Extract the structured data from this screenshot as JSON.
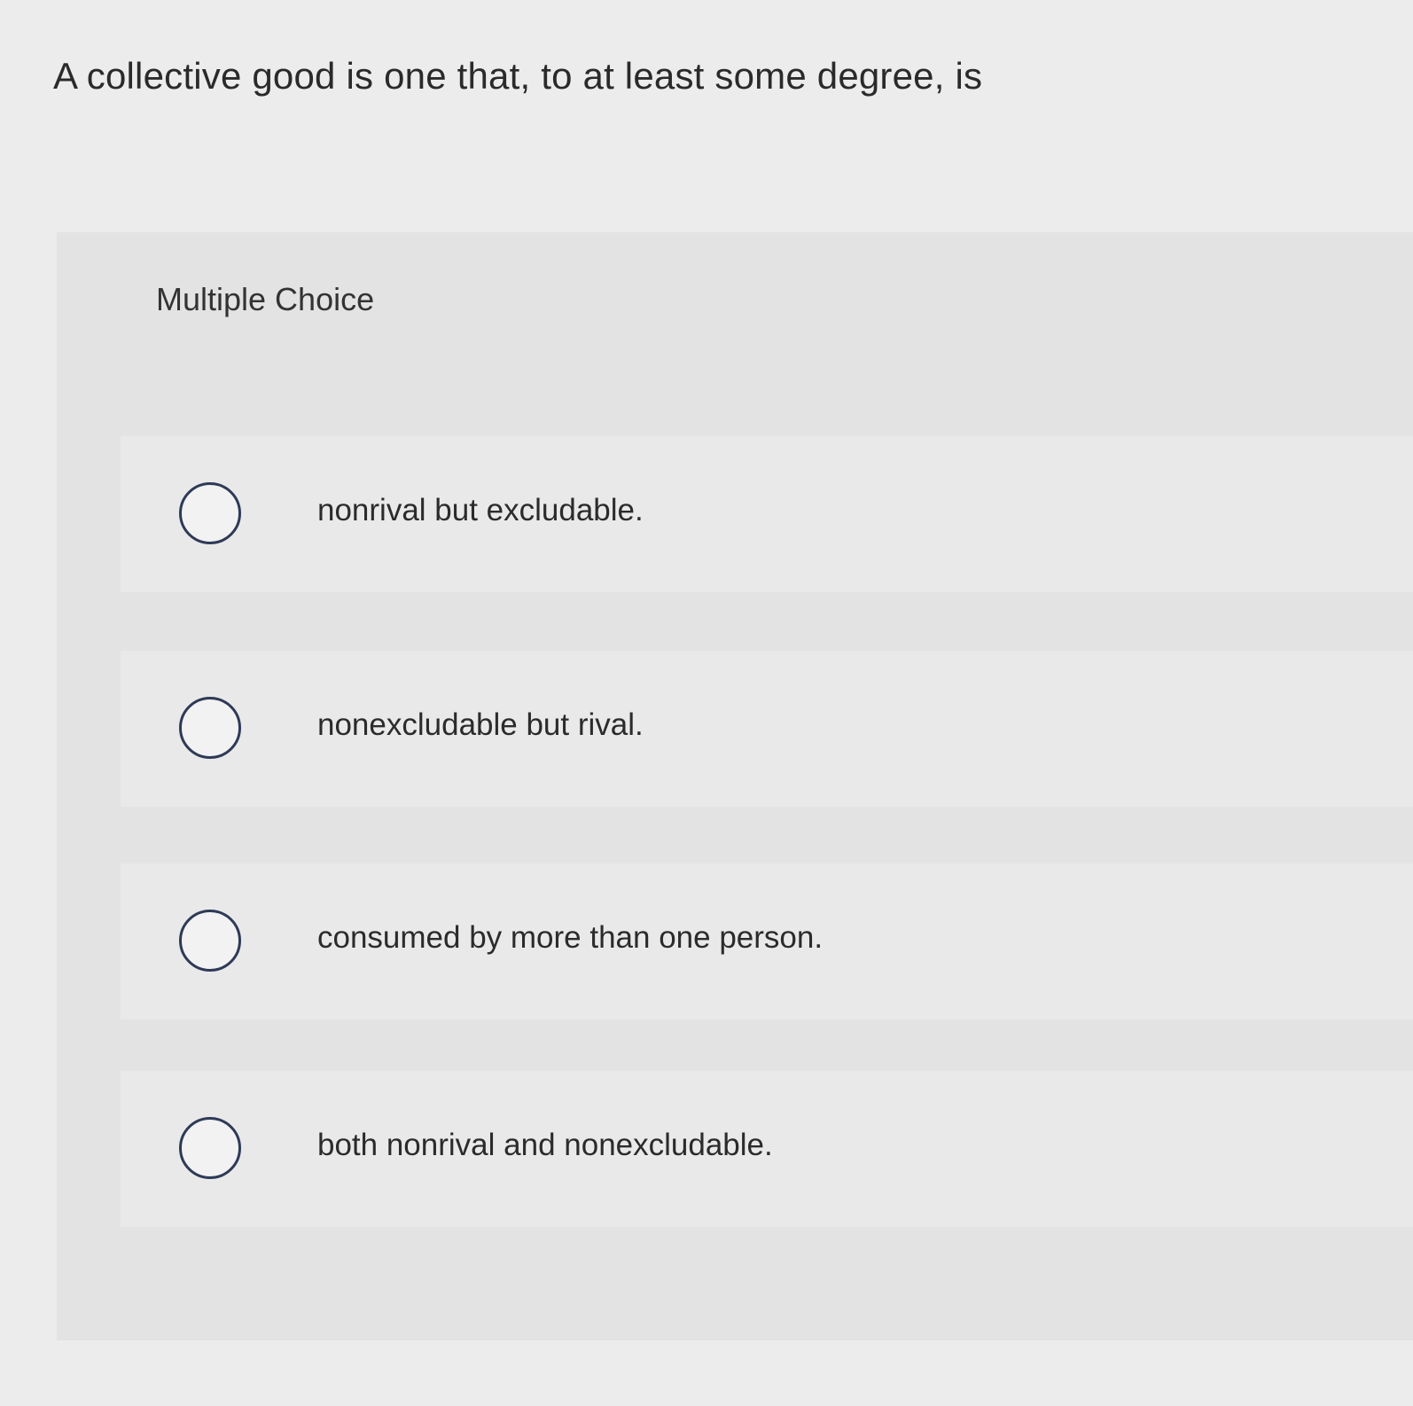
{
  "question": {
    "text": "A collective good is one that, to at least some degree, is"
  },
  "multiple_choice": {
    "header": "Multiple Choice",
    "options": [
      {
        "label": "nonrival but excludable.",
        "selected": false
      },
      {
        "label": "nonexcludable but rival.",
        "selected": false
      },
      {
        "label": "consumed by more than one person.",
        "selected": false
      },
      {
        "label": "both nonrival and nonexcludable.",
        "selected": false
      }
    ]
  }
}
